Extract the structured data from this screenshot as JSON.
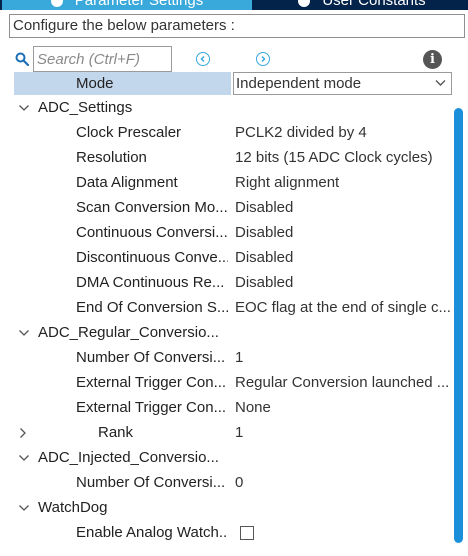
{
  "tabs": [
    {
      "label": "Parameter Settings",
      "active": true
    },
    {
      "label": "User Constants",
      "active": false
    }
  ],
  "subtitle": "Configure the below parameters :",
  "search": {
    "placeholder": "Search (Ctrl+F)",
    "value": ""
  },
  "colors": {
    "accent": "#39a9dc",
    "tab_bar": "#03234b",
    "selection": "#c3d7ec",
    "scrollbar": "#1b8fd9"
  },
  "rows": {
    "mode": {
      "label": "Mode",
      "value": "Independent mode"
    },
    "adc_settings": {
      "label": "ADC_Settings"
    },
    "clock_prescaler": {
      "label": "Clock Prescaler",
      "value": "PCLK2 divided by 4"
    },
    "resolution": {
      "label": "Resolution",
      "value": "12 bits (15 ADC Clock cycles)"
    },
    "data_alignment": {
      "label": "Data Alignment",
      "value": "Right alignment"
    },
    "scan_conversion": {
      "label": "Scan Conversion Mo...",
      "value": "Disabled"
    },
    "continuous_conversion": {
      "label": "Continuous Conversi...",
      "value": "Disabled"
    },
    "discontinuous_conversion": {
      "label": "Discontinuous Conve...",
      "value": "Disabled"
    },
    "dma_continuous": {
      "label": "DMA Continuous Re...",
      "value": "Disabled"
    },
    "end_of_conversion": {
      "label": "End Of Conversion S...",
      "value": "EOC flag at the end of single c..."
    },
    "adc_regular": {
      "label": "ADC_Regular_Conversio..."
    },
    "regular_number": {
      "label": "Number Of Conversi...",
      "value": "1"
    },
    "ext_trigger_1": {
      "label": "External Trigger Con...",
      "value": "Regular Conversion launched ..."
    },
    "ext_trigger_2": {
      "label": "External Trigger Con...",
      "value": "None"
    },
    "rank": {
      "label": "Rank",
      "value": "1"
    },
    "adc_injected": {
      "label": "ADC_Injected_Conversio..."
    },
    "injected_number": {
      "label": "Number Of Conversi...",
      "value": "0"
    },
    "watchdog": {
      "label": "WatchDog"
    },
    "enable_watchdog": {
      "label": "Enable Analog Watch...",
      "checked": false
    }
  }
}
